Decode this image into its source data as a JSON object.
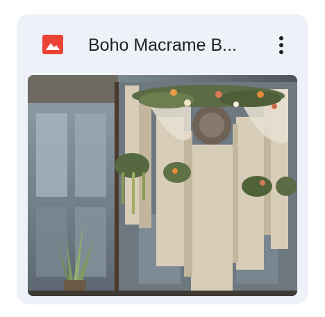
{
  "file_card": {
    "title": "Boho Macrame B...",
    "file_type_icon": "image-icon",
    "menu_icon": "more-vert-icon",
    "accent_color": "#ea4335",
    "thumbnail": {
      "subject": "macrame-wall-hanging-on-rustic-doors"
    }
  }
}
